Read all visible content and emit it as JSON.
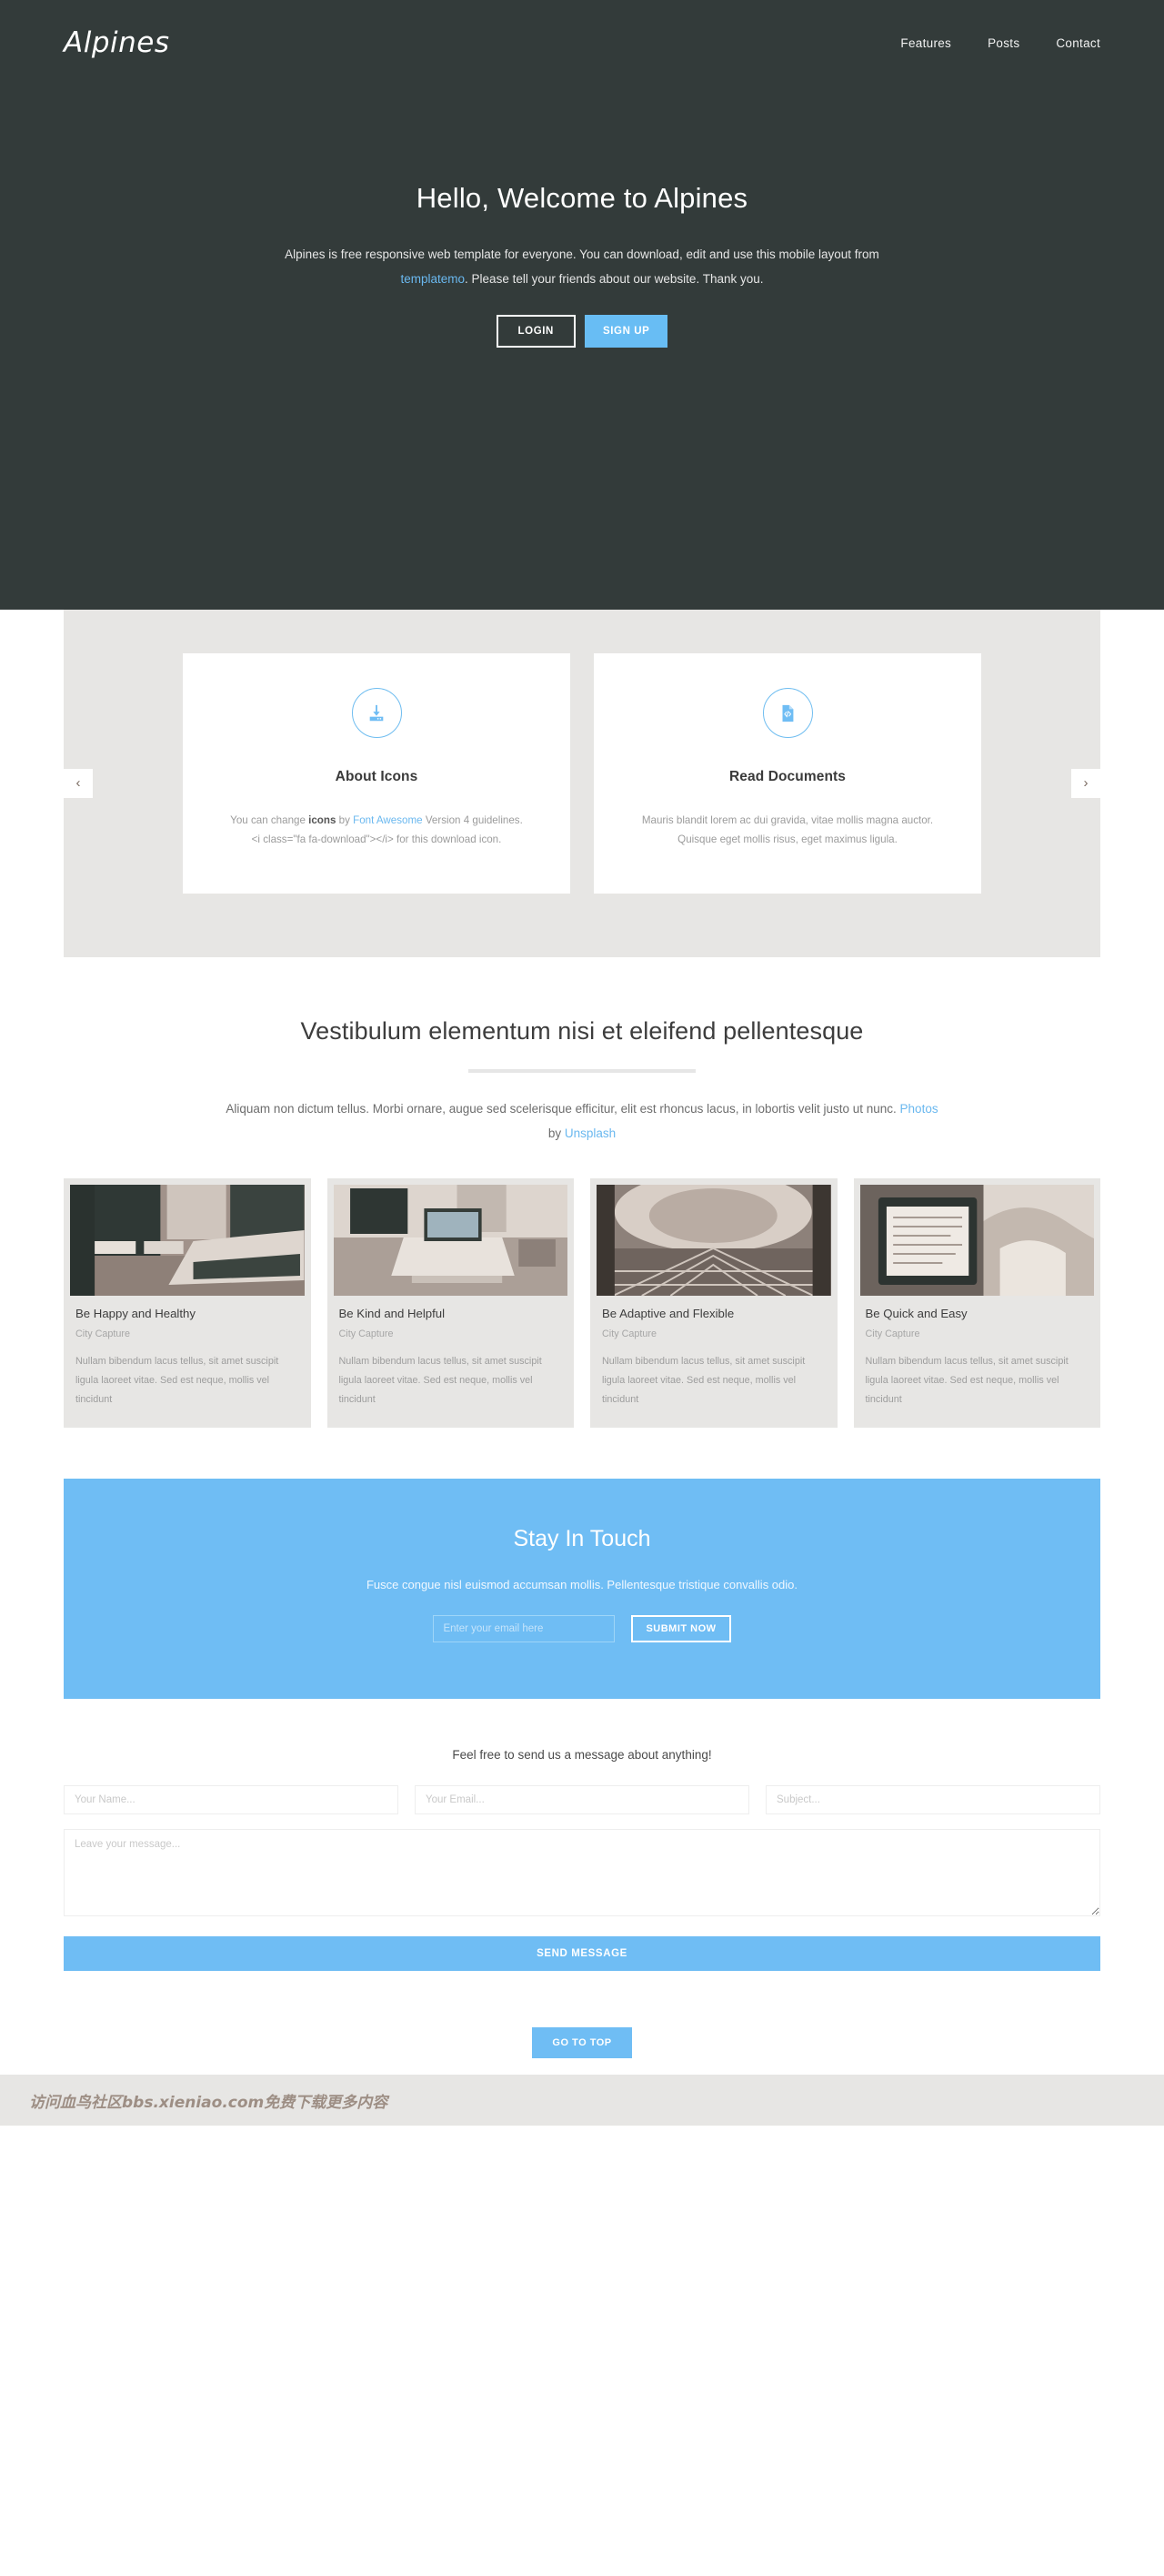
{
  "colors": {
    "hero_bg": "#333b3a",
    "accent_blue": "#6fbdf4",
    "band_grey": "#e7e6e4",
    "link_blue": "#6ab8ef"
  },
  "header": {
    "brand": "Alpines",
    "nav": [
      {
        "label": "Features"
      },
      {
        "label": "Posts"
      },
      {
        "label": "Contact"
      }
    ]
  },
  "hero": {
    "title": "Hello, Welcome to Alpines",
    "text_part1": "Alpines is free responsive web template for everyone. You can download, edit and use this mobile layout from ",
    "text_link": "templatemo",
    "text_part2": ". Please tell your friends about our website. Thank you.",
    "login_label": "LOGIN",
    "signup_label": "SIGN UP"
  },
  "carousel": {
    "prev_label": "‹",
    "next_label": "›",
    "cards": [
      {
        "icon": "download-icon",
        "title": "About Icons",
        "text_a": "You can change ",
        "text_bold": "icons",
        "text_b": " by ",
        "text_link": "Font Awesome",
        "text_c": " Version 4 guidelines. <i class=\"fa fa-download\"></i> for this download icon."
      },
      {
        "icon": "file-code-icon",
        "title": "Read Documents",
        "text_a": "Mauris blandit lorem ac dui gravida, vitae mollis magna auctor. Quisque eget mollis risus, eget maximus ligula.",
        "text_bold": "",
        "text_b": "",
        "text_link": "",
        "text_c": ""
      }
    ]
  },
  "blog": {
    "title": "Vestibulum elementum nisi et eleifend pellentesque",
    "sub_part1": "Aliquam non dictum tellus. Morbi ornare, augue sed scelerisque efficitur, elit est rhoncus lacus, in lobortis velit justo ut nunc. ",
    "sub_link1": "Photos",
    "sub_mid": " by ",
    "sub_link2": "Unsplash",
    "cards": [
      {
        "image": "city-street-car-photo",
        "title": "Be Happy and Healthy",
        "meta": "City Capture",
        "desc": "Nullam bibendum lacus tellus, sit amet suscipit ligula laoreet vitae. Sed est neque, mollis vel tincidunt"
      },
      {
        "image": "desk-laptop-photo",
        "title": "Be Kind and Helpful",
        "meta": "City Capture",
        "desc": "Nullam bibendum lacus tellus, sit amet suscipit ligula laoreet vitae. Sed est neque, mollis vel tincidunt"
      },
      {
        "image": "bridge-structure-photo",
        "title": "Be Adaptive and Flexible",
        "meta": "City Capture",
        "desc": "Nullam bibendum lacus tellus, sit amet suscipit ligula laoreet vitae. Sed est neque, mollis vel tincidunt"
      },
      {
        "image": "tablet-book-photo",
        "title": "Be Quick and Easy",
        "meta": "City Capture",
        "desc": "Nullam bibendum lacus tellus, sit amet suscipit ligula laoreet vitae. Sed est neque, mollis vel tincidunt"
      }
    ]
  },
  "subscribe": {
    "title": "Stay In Touch",
    "text": "Fusce congue nisl euismod accumsan mollis. Pellentesque tristique convallis odio.",
    "email_placeholder": "Enter your email here",
    "email_value": "",
    "button_label": "SUBMIT NOW"
  },
  "contact": {
    "lead": "Feel free to send us a message about anything!",
    "name_placeholder": "Your Name...",
    "email_placeholder": "Your Email...",
    "subject_placeholder": "Subject...",
    "message_placeholder": "Leave your message...",
    "name_value": "",
    "email_value": "",
    "subject_value": "",
    "message_value": "",
    "send_label": "SEND MESSAGE"
  },
  "footer": {
    "go_top_label": "GO TO TOP",
    "watermark": "访问血鸟社区bbs.xieniao.com免费下载更多内容"
  }
}
